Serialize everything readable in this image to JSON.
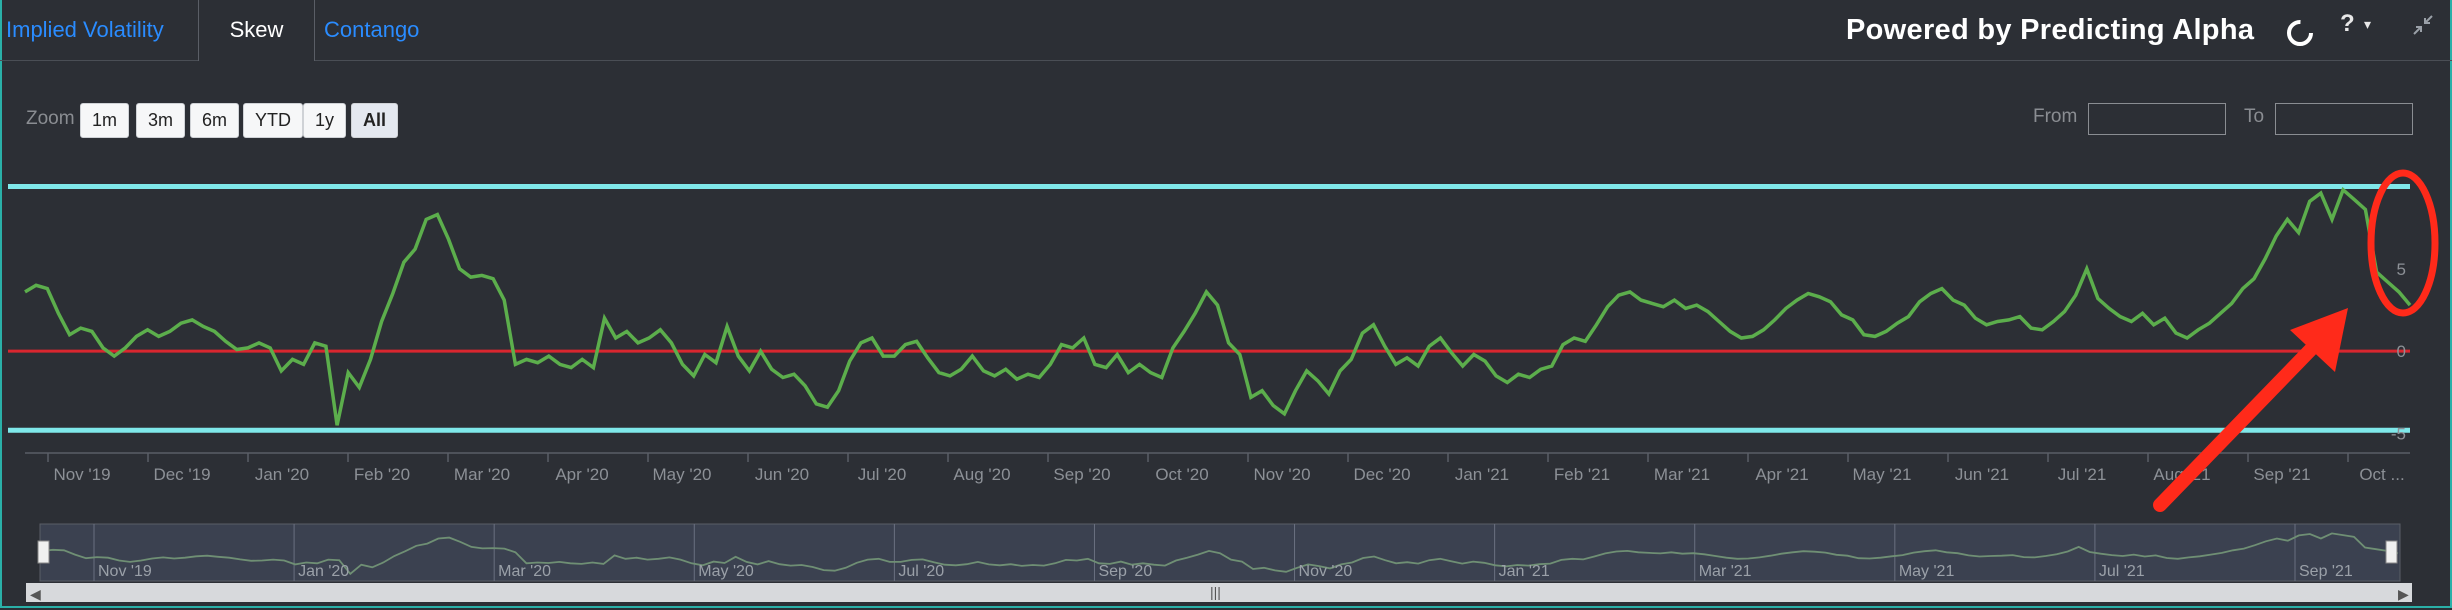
{
  "tabs": [
    {
      "label": "Implied Volatility"
    },
    {
      "label": "Skew"
    },
    {
      "label": "Contango"
    }
  ],
  "header": {
    "powered_by": "Powered by Predicting Alpha",
    "help": "?"
  },
  "zoom": {
    "label": "Zoom",
    "buttons": [
      "1m",
      "3m",
      "6m",
      "YTD",
      "1y",
      "All"
    ],
    "selected": "All"
  },
  "range": {
    "from_label": "From",
    "to_label": "To"
  },
  "colors": {
    "series": "#5cae4c",
    "zero_line": "#d9262f",
    "band": "#7fe8ea",
    "annotation": "#ff2a1a"
  },
  "chart_data": {
    "type": "line",
    "y_ticks": [
      "5",
      "0",
      "-5"
    ],
    "x_ticks": [
      "Nov '19",
      "Dec '19",
      "Jan '20",
      "Feb '20",
      "Mar '20",
      "Apr '20",
      "May '20",
      "Jun '20",
      "Jul '20",
      "Aug '20",
      "Sep '20",
      "Oct '20",
      "Nov '20",
      "Dec '20",
      "Jan '21",
      "Feb '21",
      "Mar '21",
      "Apr '21",
      "May '21",
      "Jun '21",
      "Jul '21",
      "Aug '21",
      "Sep '21",
      "Oct ..."
    ],
    "navigator_ticks": [
      "Nov '19",
      "Jan '20",
      "Mar '20",
      "May '20",
      "Jul '20",
      "Sep '20",
      "Nov '20",
      "Jan '21",
      "Mar '21",
      "May '21",
      "Jul '21",
      "Sep '21"
    ],
    "reference_lines": {
      "upper": 10,
      "zero": 0,
      "lower": -4.8
    },
    "ylim": [
      -6,
      11
    ],
    "values": [
      3.6,
      4,
      3.8,
      2.3,
      1,
      1.4,
      1.2,
      0.2,
      -0.3,
      0.2,
      0.9,
      1.3,
      0.9,
      1.2,
      1.7,
      1.9,
      1.5,
      1.2,
      0.6,
      0.1,
      0.2,
      0.5,
      0.2,
      -1.2,
      -0.5,
      -0.8,
      0.5,
      0.3,
      -4.5,
      -1.3,
      -2.2,
      -0.5,
      1.8,
      3.5,
      5.4,
      6.2,
      8.0,
      8.3,
      6.8,
      5.0,
      4.5,
      4.6,
      4.4,
      3.1,
      -0.8,
      -0.5,
      -0.7,
      -0.3,
      -0.8,
      -1.0,
      -0.5,
      -1.0,
      2.0,
      0.8,
      1.2,
      0.5,
      0.8,
      1.3,
      0.5,
      -0.8,
      -1.5,
      -0.2,
      -0.7,
      1.5,
      -0.3,
      -1.2,
      0.0,
      -1.1,
      -1.6,
      -1.4,
      -2.1,
      -3.2,
      -3.4,
      -2.4,
      -0.6,
      0.5,
      0.8,
      -0.3,
      -0.3,
      0.4,
      0.6,
      -0.4,
      -1.3,
      -1.5,
      -1.1,
      -0.3,
      -1.2,
      -1.5,
      -1.1,
      -1.7,
      -1.4,
      -1.6,
      -0.8,
      0.4,
      0.2,
      0.8,
      -0.8,
      -1.0,
      -0.2,
      -1.3,
      -0.8,
      -1.3,
      -1.6,
      0.2,
      1.2,
      2.3,
      3.6,
      2.8,
      0.5,
      -0.2,
      -2.8,
      -2.4,
      -3.3,
      -3.8,
      -2.4,
      -1.2,
      -1.8,
      -2.6,
      -1.2,
      -0.5,
      1.1,
      1.6,
      0.3,
      -0.8,
      -0.4,
      -0.9,
      0.3,
      0.8,
      -0.1,
      -0.9,
      -0.2,
      -0.6,
      -1.5,
      -1.9,
      -1.4,
      -1.6,
      -1.1,
      -0.9,
      0.4,
      0.8,
      0.6,
      1.6,
      2.7,
      3.4,
      3.6,
      3.1,
      2.9,
      2.7,
      3.1,
      2.6,
      2.8,
      2.4,
      1.8,
      1.2,
      0.8,
      0.9,
      1.3,
      1.9,
      2.6,
      3.1,
      3.5,
      3.3,
      3.0,
      2.2,
      1.9,
      1.0,
      0.9,
      1.2,
      1.7,
      2.1,
      3.0,
      3.5,
      3.8,
      3.1,
      2.8,
      2.0,
      1.6,
      1.8,
      1.9,
      2.1,
      1.4,
      1.3,
      1.8,
      2.4,
      3.4,
      5.0,
      3.2,
      2.6,
      2.1,
      1.8,
      2.3,
      1.6,
      2.0,
      1.1,
      0.8,
      1.3,
      1.7,
      2.3,
      2.9,
      3.8,
      4.4,
      5.6,
      7.0,
      8.0,
      7.2,
      9.1,
      9.6,
      8.0,
      9.8,
      9.2,
      8.6,
      4.8,
      4.2,
      3.6,
      2.8
    ]
  }
}
